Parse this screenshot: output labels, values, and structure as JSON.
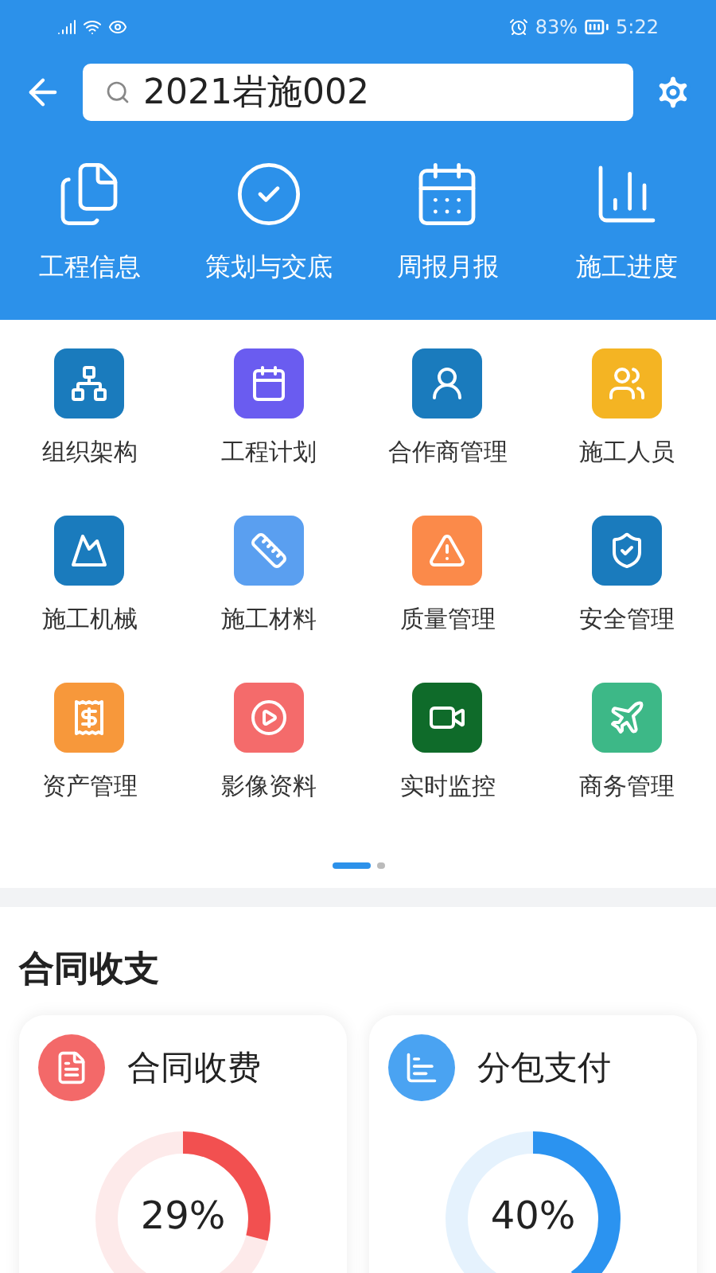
{
  "status_bar": {
    "battery": "83%",
    "time": "5:22"
  },
  "search": {
    "value": "2021岩施002"
  },
  "quick_nav": [
    {
      "label": "工程信息"
    },
    {
      "label": "策划与交底"
    },
    {
      "label": "周报月报"
    },
    {
      "label": "施工进度"
    }
  ],
  "modules": [
    {
      "label": "组织架构"
    },
    {
      "label": "工程计划"
    },
    {
      "label": "合作商管理"
    },
    {
      "label": "施工人员"
    },
    {
      "label": "施工机械"
    },
    {
      "label": "施工材料"
    },
    {
      "label": "质量管理"
    },
    {
      "label": "安全管理"
    },
    {
      "label": "资产管理"
    },
    {
      "label": "影像资料"
    },
    {
      "label": "实时监控"
    },
    {
      "label": "商务管理"
    }
  ],
  "pager": [
    {
      "selected": true
    },
    {
      "selected": false
    }
  ],
  "contract_section": {
    "title": "合同收支",
    "cards": [
      {
        "title": "合同收费",
        "level": 0.29,
        "reading": "29%",
        "color": "#f25050"
      },
      {
        "title": "分包支付",
        "level": 0.4,
        "reading": "40%",
        "color": "#2b93f0"
      }
    ]
  }
}
